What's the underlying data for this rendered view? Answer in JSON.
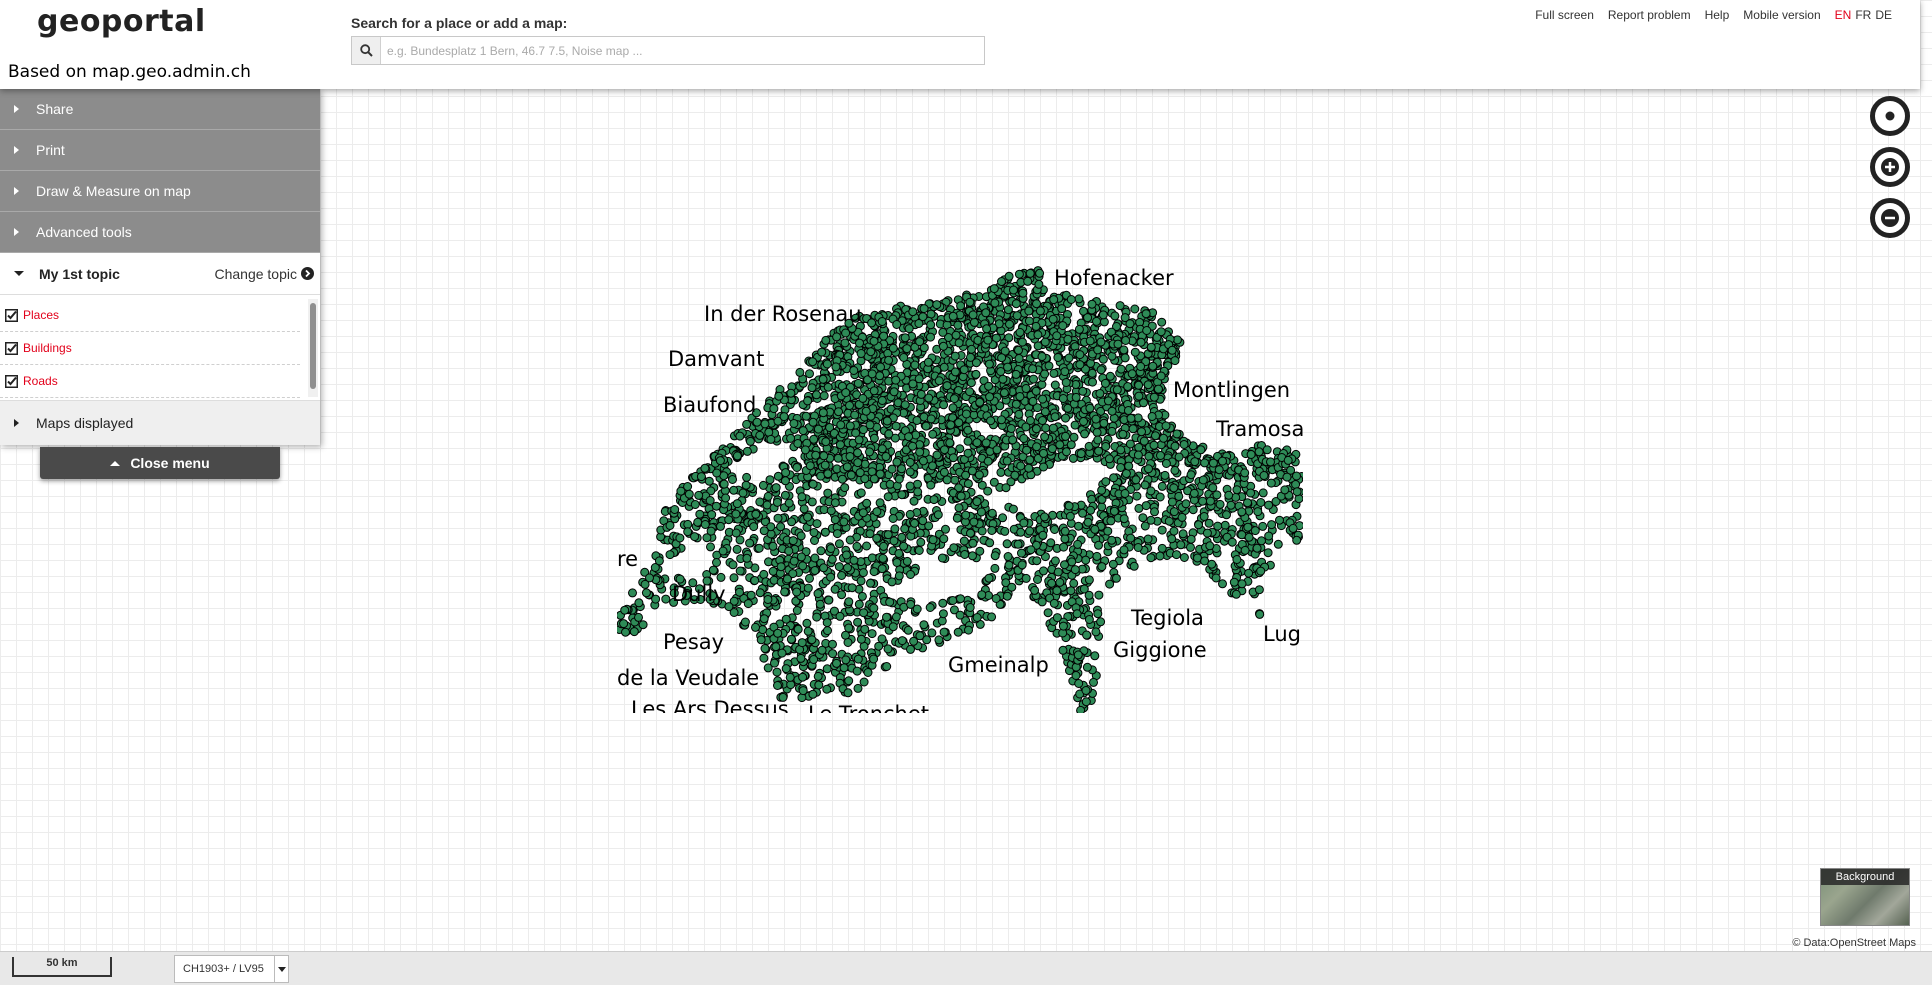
{
  "header": {
    "logo": "geoportal",
    "based_on": "Based on map.geo.admin.ch",
    "search_label": "Search for a place or add a map:",
    "search_placeholder": "e.g. Bundesplatz 1 Bern, 46.7 7.5, Noise map ...",
    "search_value": "",
    "links": [
      "Full screen",
      "Report problem",
      "Help",
      "Mobile version"
    ],
    "languages": [
      {
        "code": "EN",
        "active": true
      },
      {
        "code": "FR",
        "active": false
      },
      {
        "code": "DE",
        "active": false
      }
    ]
  },
  "menu": {
    "sections": [
      "Share",
      "Print",
      "Draw & Measure on map",
      "Advanced tools"
    ],
    "topic": {
      "title": "My 1st topic",
      "change_label": "Change topic",
      "layers": [
        {
          "name": "Places",
          "checked": true
        },
        {
          "name": "Buildings",
          "checked": true
        },
        {
          "name": "Roads",
          "checked": true
        }
      ]
    },
    "maps_displayed": "Maps displayed",
    "close_menu": "Close menu"
  },
  "map": {
    "labels": [
      "Hofenacker",
      "In der Rosenau",
      "Damvant",
      "Biaufond",
      "Montlingen",
      "Tramosa",
      "re",
      "Dully",
      "Pesay",
      "de la Veudale",
      "Les Ars Dessus",
      "Le Tronchet",
      "Gmeinalp",
      "Tegiola",
      "Giggione",
      "Lug"
    ],
    "point_fill": "#2e8b57",
    "point_stroke": "#000000",
    "controls": [
      "locate-icon",
      "zoom-in-icon",
      "zoom-out-icon"
    ]
  },
  "background_switch": {
    "label": "Background"
  },
  "attribution": {
    "text": "© Data:OpenStreet Maps"
  },
  "footer": {
    "scale": "50 km",
    "crs": "CH1903+ / LV95"
  },
  "colors": {
    "accent_red": "#e2001a",
    "menu_gray": "#8c8c8c",
    "button_dark": "#4a4a4a"
  }
}
